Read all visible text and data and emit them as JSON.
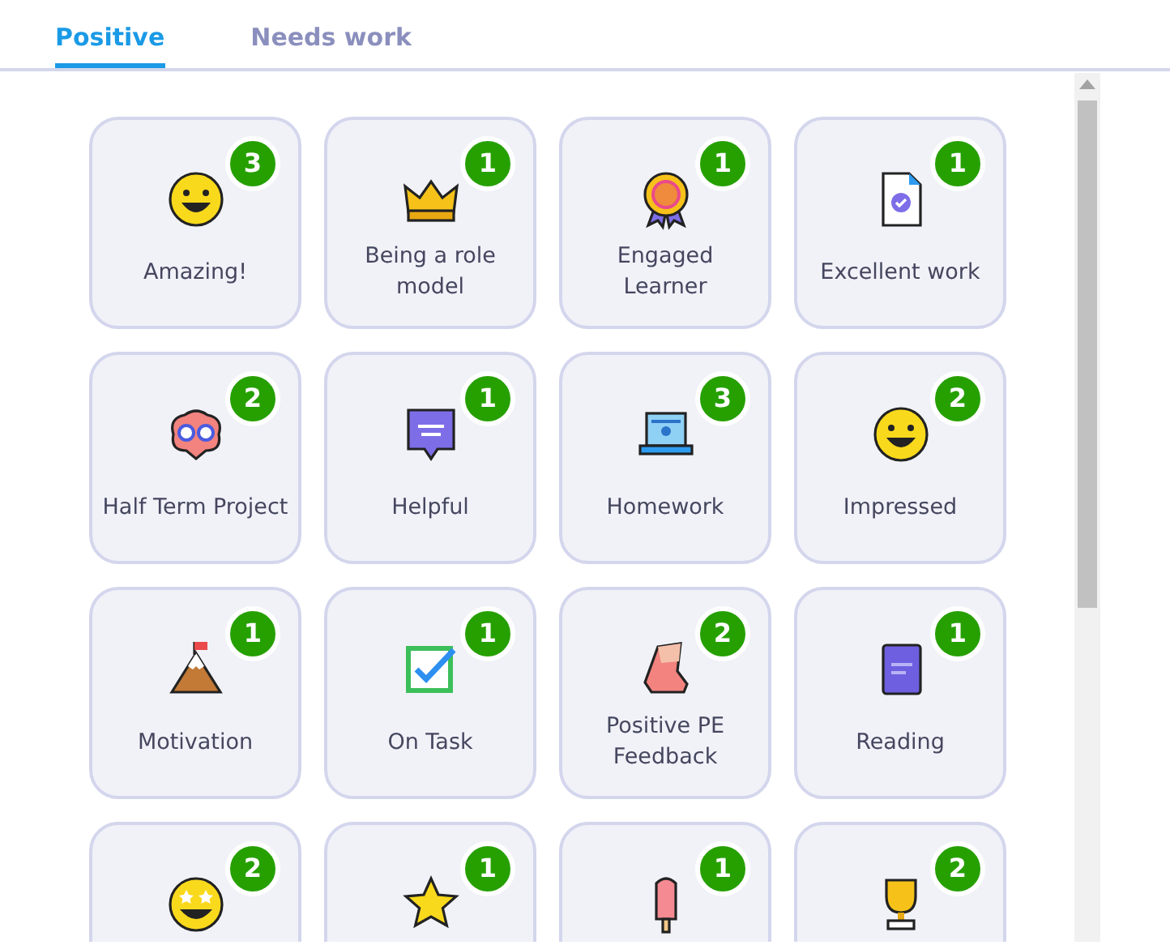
{
  "tabs": [
    {
      "label": "Positive",
      "selected": true
    },
    {
      "label": "Needs work",
      "selected": false
    }
  ],
  "skills": [
    {
      "label": "Amazing!",
      "count": "3"
    },
    {
      "label": "Being a role model",
      "count": "1"
    },
    {
      "label": "Engaged Learner",
      "count": "1"
    },
    {
      "label": "Excellent work",
      "count": "1"
    },
    {
      "label": "Half Term Project",
      "count": "2"
    },
    {
      "label": "Helpful",
      "count": "1"
    },
    {
      "label": "Homework",
      "count": "3"
    },
    {
      "label": "Impressed",
      "count": "2"
    },
    {
      "label": "Motivation",
      "count": "1"
    },
    {
      "label": "On Task",
      "count": "1"
    },
    {
      "label": "Positive PE Feedback",
      "count": "2"
    },
    {
      "label": "Reading",
      "count": "1"
    },
    {
      "count": "2"
    },
    {
      "count": "1"
    },
    {
      "count": "1"
    },
    {
      "count": "2"
    }
  ]
}
